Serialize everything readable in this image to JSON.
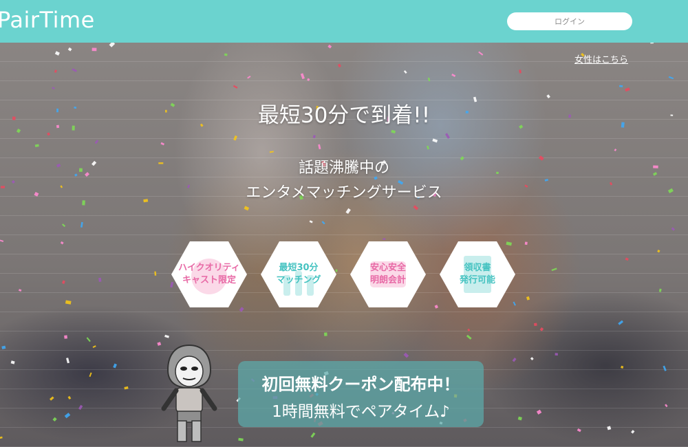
{
  "header": {
    "logo": "PairTime",
    "login_label": "ログイン"
  },
  "hero": {
    "women_link": "女性はこちら",
    "headline": "最短30分で到着!!",
    "subline1": "話題沸騰中の",
    "subline2": "エンタメマッチングサービス"
  },
  "features": [
    {
      "line1": "ハイクオリティ",
      "line2": "キャスト限定",
      "icon": "cast-icon"
    },
    {
      "line1": "最短30分",
      "line2": "マッチング",
      "icon": "glasses-icon"
    },
    {
      "line1": "安心安全",
      "line2": "明朗会計",
      "icon": "card-icon"
    },
    {
      "line1": "領収書",
      "line2": "発行可能",
      "icon": "receipt-icon"
    }
  ],
  "coupon": {
    "line1": "初回無料クーポン配布中！",
    "line2": "1時間無料でペアタイム♪"
  },
  "colors": {
    "brand": "#6bd3cf",
    "pink": "#e86aa6",
    "teal": "#46c3c1"
  }
}
